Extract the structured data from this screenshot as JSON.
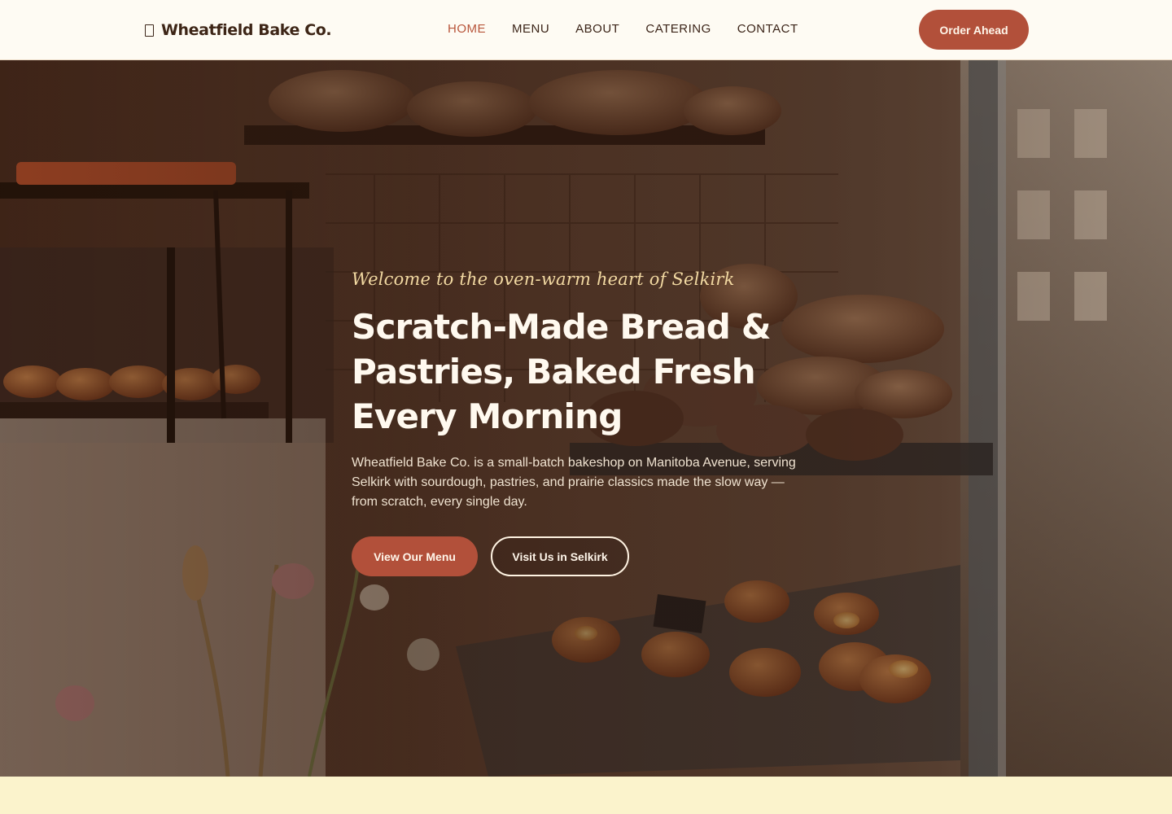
{
  "brand": {
    "name": "Wheatfield Bake Co.",
    "icon": "bread-icon"
  },
  "nav": {
    "items": [
      {
        "label": "HOME",
        "active": true
      },
      {
        "label": "MENU",
        "active": false
      },
      {
        "label": "ABOUT",
        "active": false
      },
      {
        "label": "CATERING",
        "active": false
      },
      {
        "label": "CONTACT",
        "active": false
      }
    ]
  },
  "header": {
    "cta_label": "Order Ahead"
  },
  "hero": {
    "eyebrow": "Welcome to the oven-warm heart of Selkirk",
    "headline": "Scratch-Made Bread & Pastries, Baked Fresh Every Morning",
    "lead": "Wheatfield Bake Co. is a small-batch bakeshop on Manitoba Avenue, serving Selkirk with sourdough, pastries, and prairie classics made the slow way — from scratch, every single day.",
    "primary_cta": "View Our Menu",
    "secondary_cta": "Visit Us in Selkirk"
  },
  "colors": {
    "accent": "#b2503a",
    "header_bg": "#fefbf3",
    "eyebrow": "#f2d9a2",
    "strip_bg": "#fbf3cc"
  }
}
